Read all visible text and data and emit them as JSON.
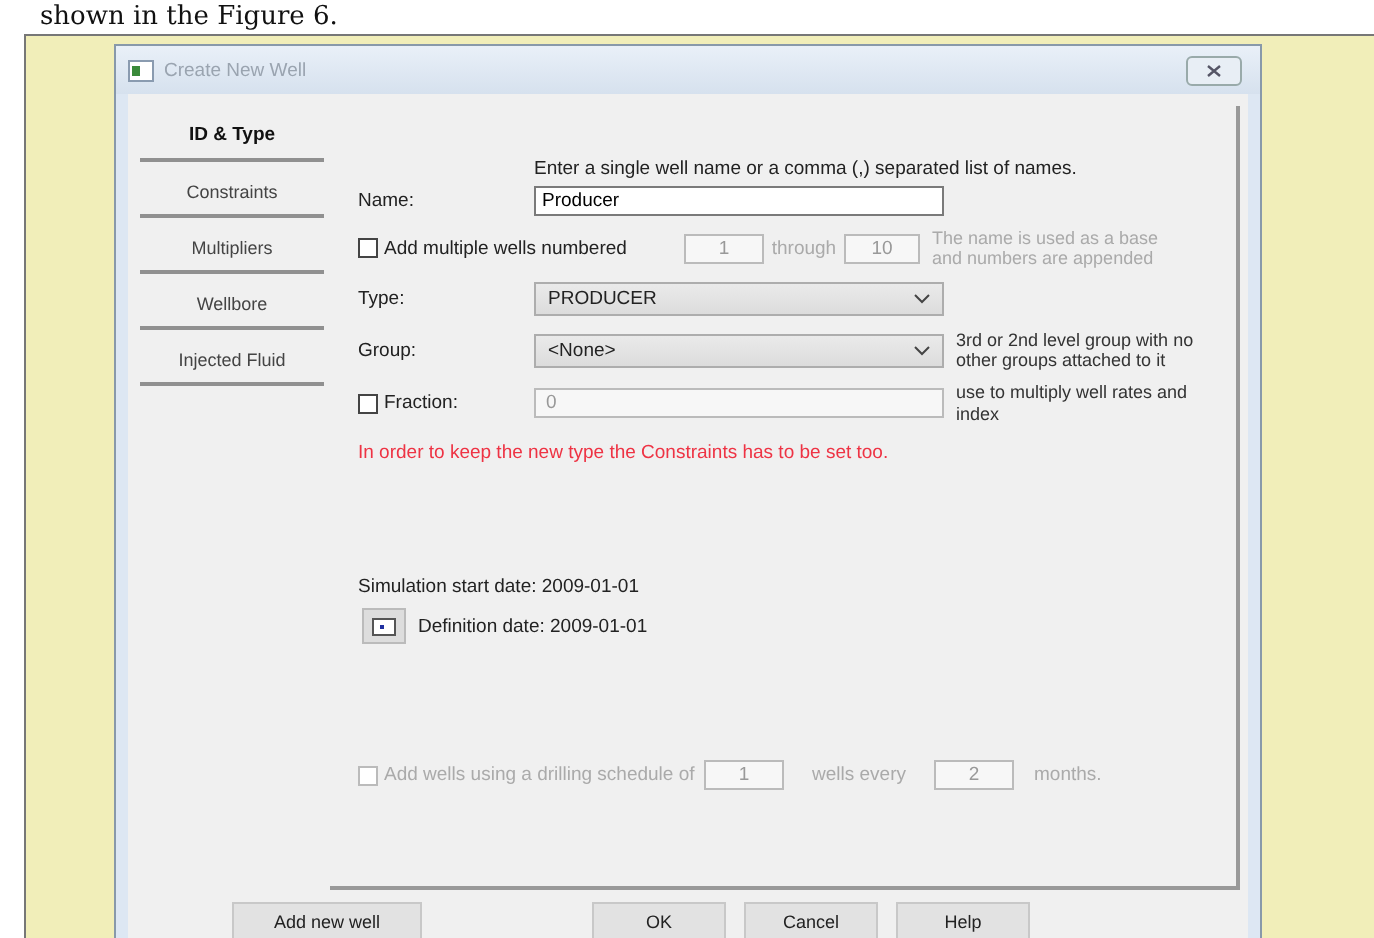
{
  "page_text": "shown in the Figure 6.",
  "window": {
    "title": "Create New Well"
  },
  "tabs": [
    {
      "label": "ID & Type",
      "selected": true
    },
    {
      "label": "Constraints",
      "selected": false
    },
    {
      "label": "Multipliers",
      "selected": false
    },
    {
      "label": "Wellbore",
      "selected": false
    },
    {
      "label": "Injected Fluid",
      "selected": false
    }
  ],
  "hint": "Enter a single well name or a comma (,) separated list of names.",
  "name": {
    "label": "Name:",
    "value": "Producer"
  },
  "multiple": {
    "label": "Add multiple wells numbered",
    "checked": false,
    "from": "1",
    "through_label": "through",
    "to": "10",
    "note": "The name is used as a base and numbers are appended"
  },
  "type": {
    "label": "Type:",
    "value": "PRODUCER"
  },
  "group": {
    "label": "Group:",
    "value": "<None>",
    "note": "3rd or 2nd level group with no other groups attached to it"
  },
  "fraction": {
    "label": "Fraction:",
    "checked": false,
    "value": "0",
    "note": "use to multiply well rates and index"
  },
  "warning": "In order to keep the new type the Constraints has to be set too.",
  "simulation_start": "Simulation start date: 2009-01-01",
  "definition_date": "Definition date: 2009-01-01",
  "schedule": {
    "label": "Add wells using a drilling schedule of",
    "checked": false,
    "disabled": true,
    "count": "1",
    "every_label": "wells every",
    "interval": "2",
    "unit": "months."
  },
  "buttons": [
    {
      "label": "Add new well"
    },
    {
      "label": "OK"
    },
    {
      "label": "Cancel"
    },
    {
      "label": "Help"
    }
  ]
}
